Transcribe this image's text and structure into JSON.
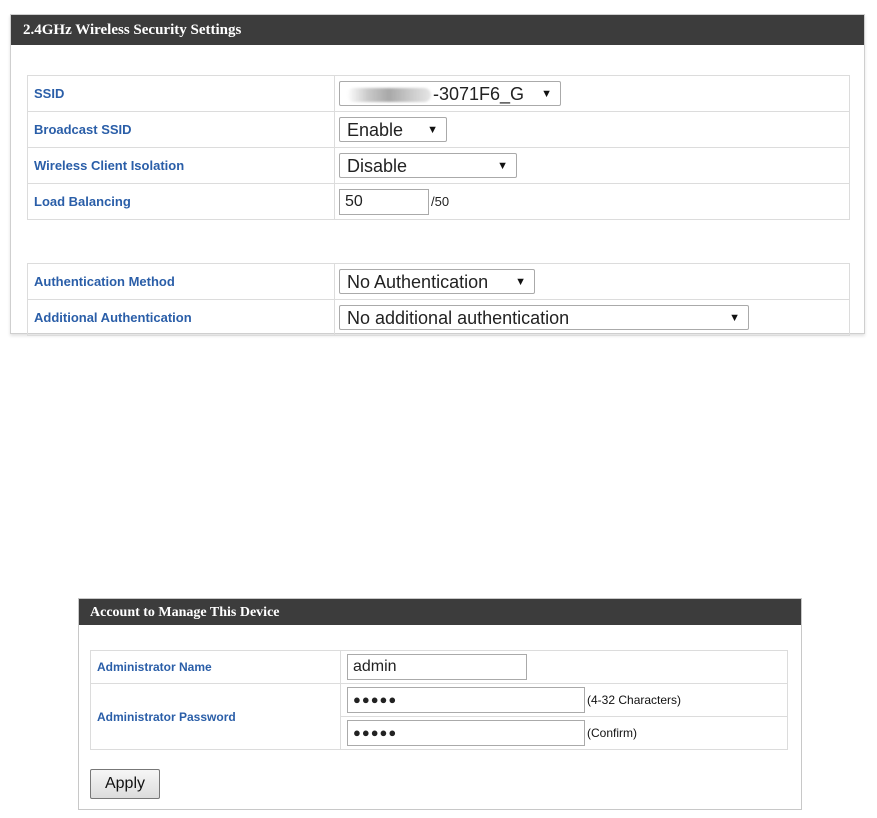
{
  "wireless": {
    "title": "2.4GHz Wireless Security Settings",
    "ssid": {
      "label": "SSID",
      "value": "-3071F6_G"
    },
    "broadcast": {
      "label": "Broadcast SSID",
      "value": "Enable"
    },
    "isolation": {
      "label": "Wireless Client Isolation",
      "value": "Disable"
    },
    "load": {
      "label": "Load Balancing",
      "value": "50",
      "suffix": "/50"
    },
    "auth_method": {
      "label": "Authentication Method",
      "value": "No Authentication"
    },
    "additional": {
      "label": "Additional Authentication",
      "value": "No additional authentication"
    },
    "arrow": "▼"
  },
  "account": {
    "title": "Account to Manage This Device",
    "name": {
      "label": "Administrator Name",
      "value": "admin"
    },
    "password": {
      "label": "Administrator Password",
      "value": "●●●●●",
      "note": "(4-32 Characters)"
    },
    "confirm": {
      "value": "●●●●●",
      "note": "(Confirm)"
    },
    "apply_label": "Apply"
  }
}
